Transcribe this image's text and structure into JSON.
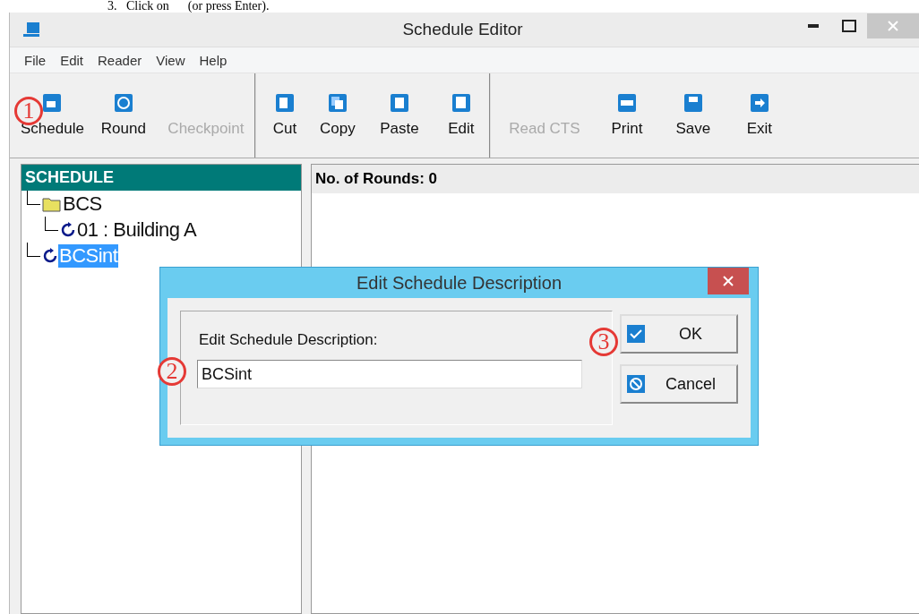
{
  "caption": "3.   Click on      (or press Enter).",
  "window": {
    "title": "Schedule Editor"
  },
  "menu": [
    "File",
    "Edit",
    "Reader",
    "View",
    "Help"
  ],
  "toolbar": [
    {
      "group": [
        {
          "label": "Schedule",
          "disabled": false
        },
        {
          "label": "Round",
          "disabled": false
        },
        {
          "label": "Checkpoint",
          "disabled": true
        }
      ]
    },
    {
      "group": [
        {
          "label": "Cut",
          "disabled": false
        },
        {
          "label": "Copy",
          "disabled": false
        },
        {
          "label": "Paste",
          "disabled": false
        },
        {
          "label": "Edit",
          "disabled": false
        }
      ]
    },
    {
      "group": [
        {
          "label": "Read CTS",
          "disabled": true
        },
        {
          "label": "Print",
          "disabled": false
        },
        {
          "label": "Save",
          "disabled": false
        },
        {
          "label": "Exit",
          "disabled": false
        }
      ]
    }
  ],
  "tree": {
    "header": "SCHEDULE",
    "items": [
      {
        "label": "BCS",
        "kind": "folder",
        "selected": false,
        "children": [
          {
            "label": "01 : Building A",
            "kind": "round",
            "selected": false
          }
        ]
      },
      {
        "label": "BCSint",
        "kind": "round",
        "selected": true
      }
    ]
  },
  "details": {
    "header": "No. of Rounds: 0"
  },
  "dialog": {
    "title": "Edit Schedule Description",
    "label": "Edit Schedule Description:",
    "value": "BCSint",
    "buttons": [
      {
        "label": "OK",
        "kind": "ok"
      },
      {
        "label": "Cancel",
        "kind": "cancel"
      }
    ]
  },
  "callouts": [
    "1",
    "2",
    "3"
  ]
}
